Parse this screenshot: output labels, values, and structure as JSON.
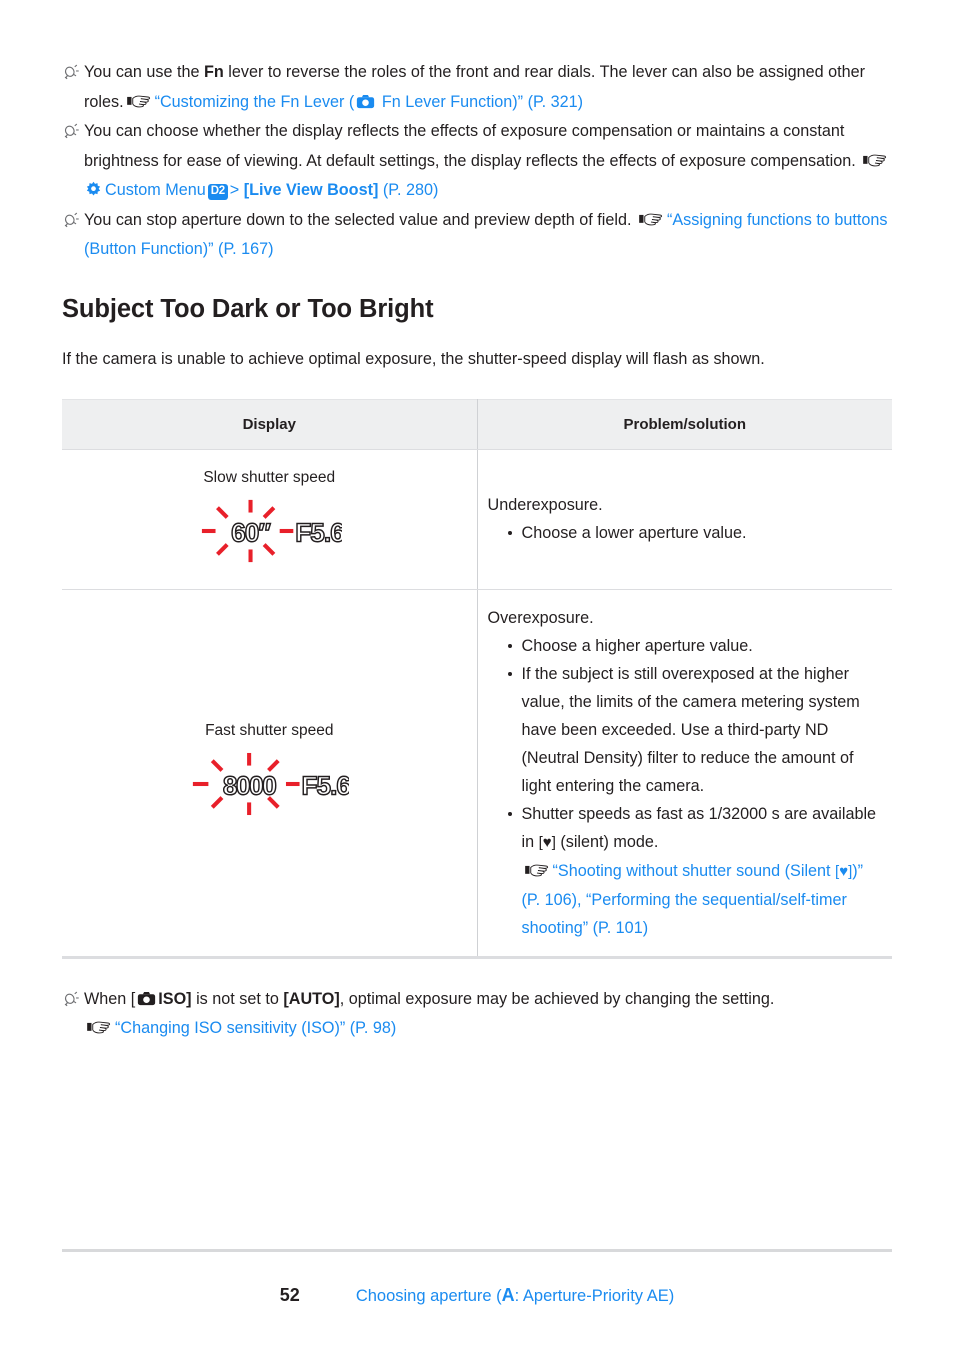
{
  "tips_top": [
    {
      "id": "fn-lever",
      "icon": "tip-bulb-icon",
      "segments": [
        {
          "t": "text",
          "v": "You can use the "
        },
        {
          "t": "bold",
          "v": "Fn"
        },
        {
          "t": "text",
          "v": " lever to reverse the roles of the front and rear dials. The lever can also be assigned other roles. "
        },
        {
          "t": "pointer-icon",
          "v": "☞"
        },
        {
          "t": "link",
          "v": "“Customizing the Fn Lever ("
        },
        {
          "t": "camera-icon",
          "v": "camera"
        },
        {
          "t": "link",
          "v": " Fn Lever Function)” (P. 321)"
        }
      ],
      "plain": "You can use the Fn lever to reverse the roles of the front and rear dials. The lever can also be assigned other roles. ☞ “Customizing the Fn Lever (■ Fn Lever Function)” (P. 321)",
      "link_text": "“Customizing the Fn Lever (",
      "link_text2": " Fn Lever Function)” (P. 321)"
    },
    {
      "id": "live-view-boost",
      "icon": "tip-bulb-icon",
      "plain": "You can choose whether the display reflects the effects of exposure compensation or maintains a constant brightness for ease of viewing. At default settings, the display reflects the effects of exposure compensation. ☞ ⚙ Custom Menu D2 > [Live View Boost] (P. 280)",
      "body": "You can choose whether the display reflects the effects of exposure compensation or maintains a constant brightness for ease of viewing. At default settings, the display reflects the effects of exposure compensation. ",
      "custom_menu_label": "Custom Menu",
      "badge": "D2",
      "separator": ">",
      "setting_label": "[Live View Boost]",
      "page_ref": "(P. 280)"
    },
    {
      "id": "depth-of-field-preview",
      "icon": "tip-bulb-icon",
      "body": "You can stop aperture down to the selected value and preview depth of field. ",
      "link": "“Assigning functions to buttons (Button Function)” (P. 167)",
      "plain": "You can stop aperture down to the selected value and preview depth of field. ☞ “Assigning functions to buttons (Button Function)” (P. 167)"
    }
  ],
  "section": {
    "title": "Subject Too Dark or Too Bright",
    "intro": "If the camera is unable to achieve optimal exposure, the shutter-speed display will flash as shown."
  },
  "table": {
    "headers": [
      "Display",
      "Problem/solution"
    ],
    "rows": [
      {
        "display_label": "Slow shutter speed",
        "shutter_value": "60″",
        "aperture_value": "F5.6",
        "flashing": true,
        "solution_lead": "Underexposure.",
        "bullets": [
          {
            "id": "lower-aperture",
            "text": "Choose a lower aperture value."
          }
        ]
      },
      {
        "display_label": "Fast shutter speed",
        "shutter_value": "8000",
        "aperture_value": "F5.6",
        "flashing": true,
        "solution_lead": "Overexposure.",
        "bullets": [
          {
            "id": "higher-aperture",
            "text": "Choose a higher aperture value."
          },
          {
            "id": "nd-filter",
            "text": "If the subject is still overexposed at the higher value, the limits of the camera metering system have been exceeded. Use a third-party ND (Neutral Density) filter to reduce the amount of light entering the camera."
          },
          {
            "id": "silent-mode",
            "text_before": "Shutter speeds as fast as 1/32000 s are available in ",
            "silent_symbol": "♥",
            "text_after": " (silent) mode.",
            "link1": "“Shooting without shutter sound (Silent ",
            "link1_end": ")” (P. 106)",
            "link_separator": ", ",
            "link2": "“Performing the sequential/self-timer shooting” (P. 101)"
          }
        ]
      }
    ]
  },
  "note_bottom": {
    "icon": "tip-bulb-icon",
    "text_before": "When [",
    "camera_iso": "ISO]",
    "text_mid": " is not set to ",
    "auto_label": "[AUTO]",
    "text_after": ", optimal exposure may be achieved by changing the setting.",
    "link": "“Changing ISO sensitivity (ISO)” (P. 98)",
    "plain": "When [■ ISO] is not set to [AUTO], optimal exposure may be achieved by changing the setting. ☞ “Changing ISO sensitivity (ISO)” (P. 98)"
  },
  "footer": {
    "page_number": "52",
    "chapter_before": "Choosing aperture (",
    "mode_letter": "A",
    "chapter_after": ": Aperture-Priority AE)"
  },
  "colors": {
    "link_blue": "#1a8bf0",
    "text_black": "#231f20",
    "flash_red": "#e8202a",
    "table_header_bg": "#eeeff0",
    "rule_gray": "#d8d9db"
  }
}
